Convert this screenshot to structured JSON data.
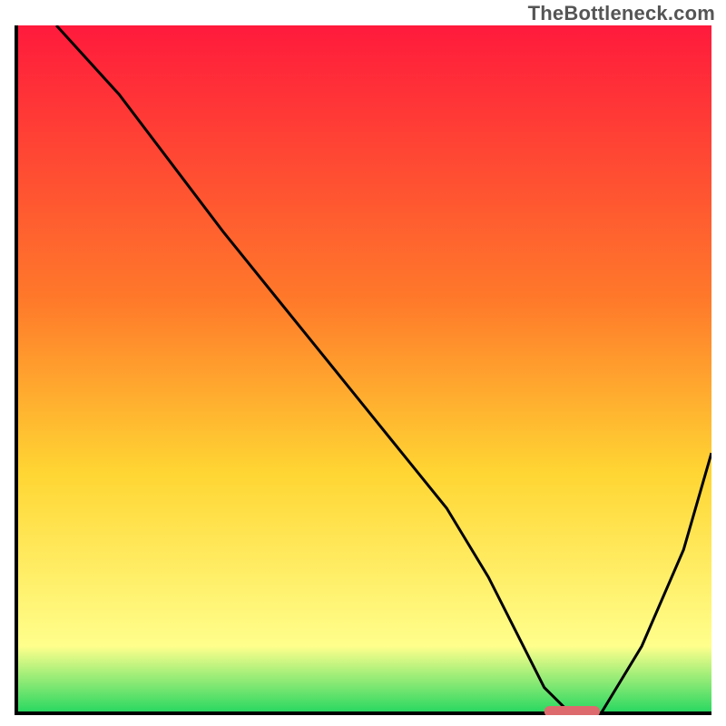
{
  "watermark": "TheBottleneck.com",
  "colors": {
    "frame": "#000000",
    "curve": "#000000",
    "marker": "#dd6b6e",
    "grad_top": "#ff1a3c",
    "grad_mid1": "#ff7a2a",
    "grad_mid2": "#ffd633",
    "grad_mid3": "#ffff8c",
    "grad_bottom": "#1fd65f"
  },
  "chart_data": {
    "type": "line",
    "title": "",
    "xlabel": "",
    "ylabel": "",
    "xlim": [
      0,
      100
    ],
    "ylim": [
      0,
      100
    ],
    "x": [
      6,
      15,
      24,
      30,
      38,
      46,
      54,
      62,
      68,
      72,
      76,
      80,
      84,
      90,
      96,
      100
    ],
    "y": [
      100,
      90,
      78,
      70,
      60,
      50,
      40,
      30,
      20,
      12,
      4,
      0,
      0,
      10,
      24,
      38
    ],
    "comment": "Values read from axis-free plot; y is approximate percent of plot height from bottom.",
    "marker": {
      "x_center": 80,
      "width": 8,
      "y": 0
    },
    "gradient_stops": [
      {
        "offset": 0.0,
        "key": "grad_top"
      },
      {
        "offset": 0.4,
        "key": "grad_mid1"
      },
      {
        "offset": 0.65,
        "key": "grad_mid2"
      },
      {
        "offset": 0.9,
        "key": "grad_mid3"
      },
      {
        "offset": 1.0,
        "key": "grad_bottom"
      }
    ]
  }
}
